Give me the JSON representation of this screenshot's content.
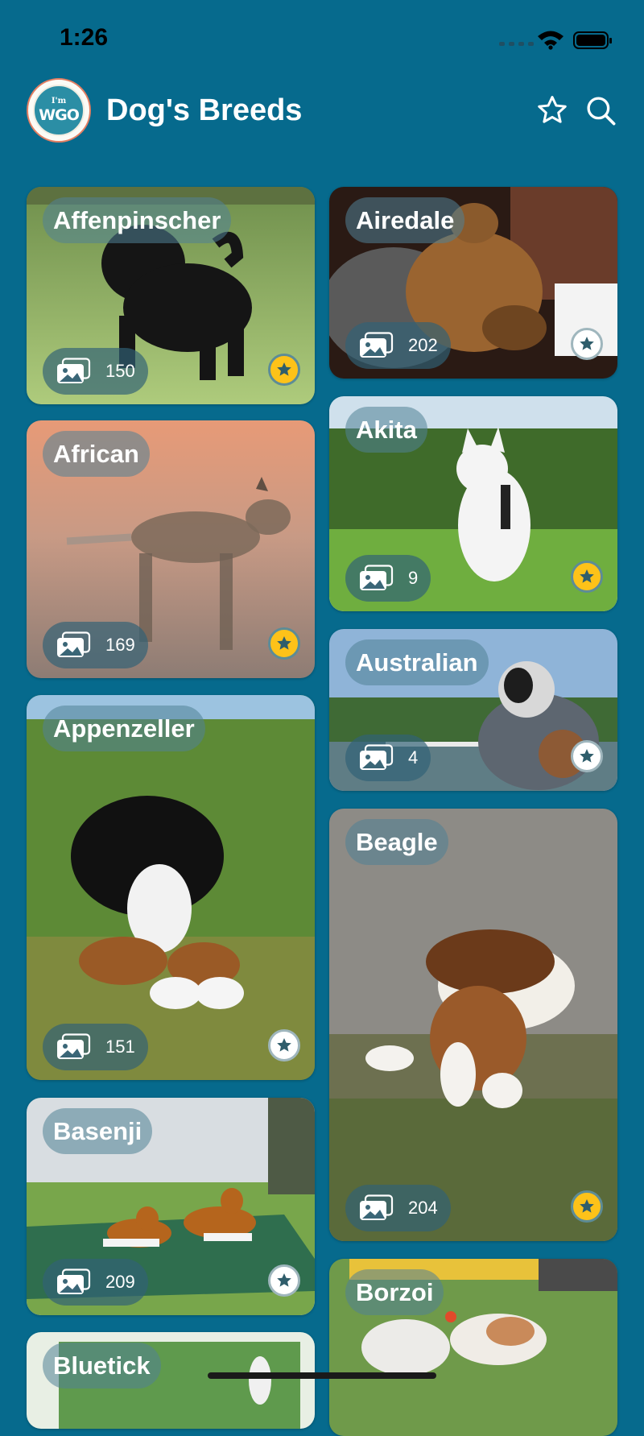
{
  "status_bar": {
    "time": "1:26"
  },
  "app": {
    "title": "Dog's Breeds",
    "logo_small": "I'm",
    "logo_main": "WGO"
  },
  "breeds": [
    {
      "name": "Affenpinscher",
      "count": "150",
      "favorite": true
    },
    {
      "name": "African",
      "count": "169",
      "favorite": true
    },
    {
      "name": "Appenzeller",
      "count": "151",
      "favorite": false
    },
    {
      "name": "Basenji",
      "count": "209",
      "favorite": false
    },
    {
      "name": "Bluetick",
      "count": "",
      "favorite": false
    },
    {
      "name": "Airedale",
      "count": "202",
      "favorite": false
    },
    {
      "name": "Akita",
      "count": "9",
      "favorite": true
    },
    {
      "name": "Australian",
      "count": "4",
      "favorite": false
    },
    {
      "name": "Beagle",
      "count": "204",
      "favorite": true
    },
    {
      "name": "Borzoi",
      "count": "",
      "favorite": false
    }
  ],
  "icons": {
    "favorites": "star-outline-icon",
    "search": "magnifier-icon",
    "gallery": "photos-icon",
    "favorite_marker": "star-icon"
  },
  "colors": {
    "background": "#066a8d",
    "favorite_on": "#fdc219",
    "favorite_off": "#ffffff",
    "star_dark": "#2f5d6b"
  }
}
